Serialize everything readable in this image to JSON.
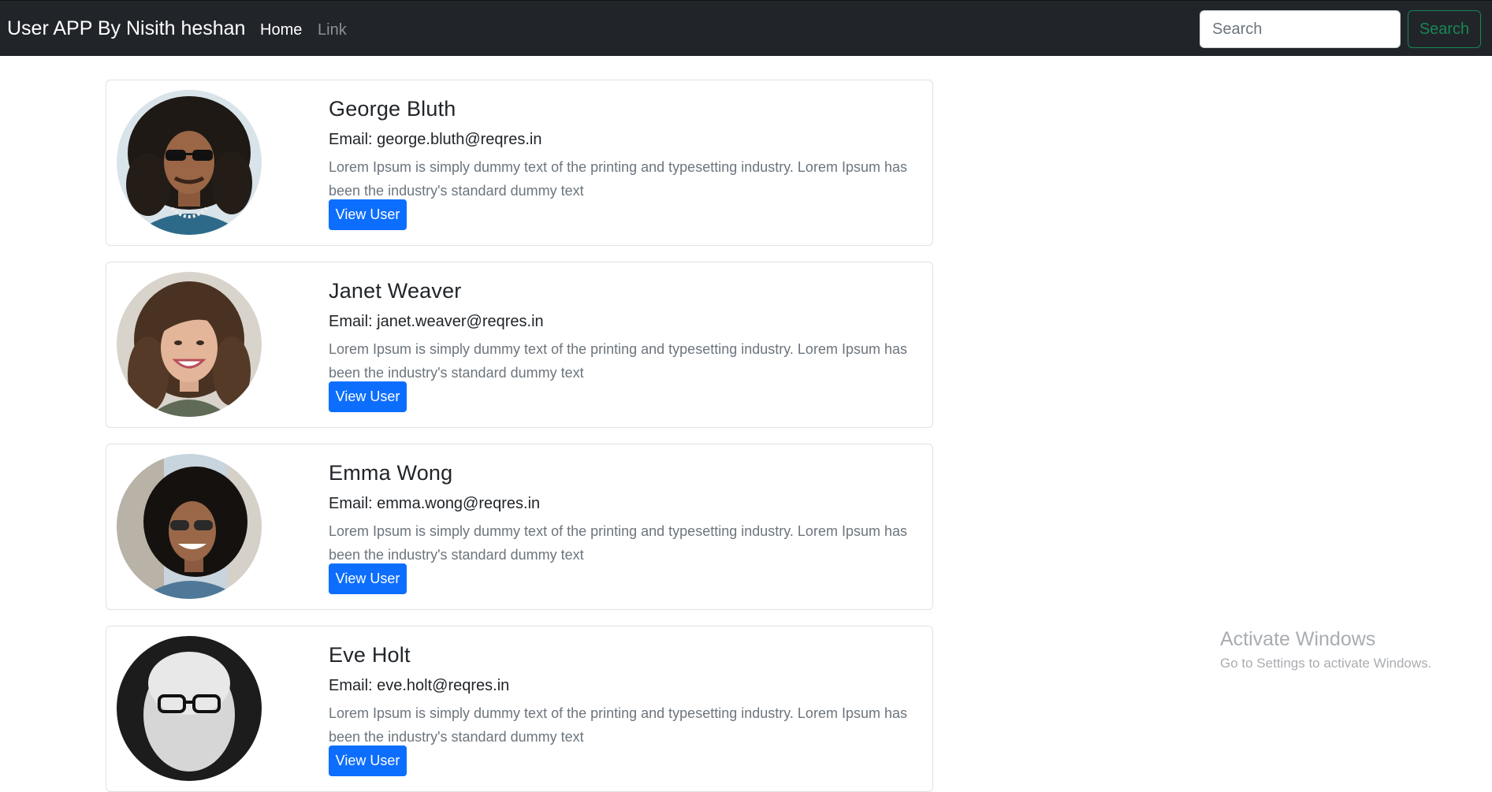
{
  "navbar": {
    "brand": "User APP By Nisith heshan",
    "links": [
      "Home",
      "Link"
    ],
    "search_placeholder": "Search",
    "search_button": "Search"
  },
  "users": [
    {
      "name": "George Bluth",
      "email_label": "Email: george.bluth@reqres.in",
      "description": "Lorem Ipsum is simply dummy text of the printing and typesetting industry. Lorem Ipsum has been the industry's standard dummy text",
      "button": "View User"
    },
    {
      "name": "Janet Weaver",
      "email_label": "Email: janet.weaver@reqres.in",
      "description": "Lorem Ipsum is simply dummy text of the printing and typesetting industry. Lorem Ipsum has been the industry's standard dummy text",
      "button": "View User"
    },
    {
      "name": "Emma Wong",
      "email_label": "Email: emma.wong@reqres.in",
      "description": "Lorem Ipsum is simply dummy text of the printing and typesetting industry. Lorem Ipsum has been the industry's standard dummy text",
      "button": "View User"
    },
    {
      "name": "Eve Holt",
      "email_label": "Email: eve.holt@reqres.in",
      "description": "Lorem Ipsum is simply dummy text of the printing and typesetting industry. Lorem Ipsum has been the industry's standard dummy text",
      "button": "View User"
    }
  ],
  "watermark": {
    "title": "Activate Windows",
    "subtitle": "Go to Settings to activate Windows."
  },
  "colors": {
    "navbar_bg": "#212529",
    "primary": "#0d6efd",
    "success": "#198754",
    "muted": "#6c757d"
  }
}
